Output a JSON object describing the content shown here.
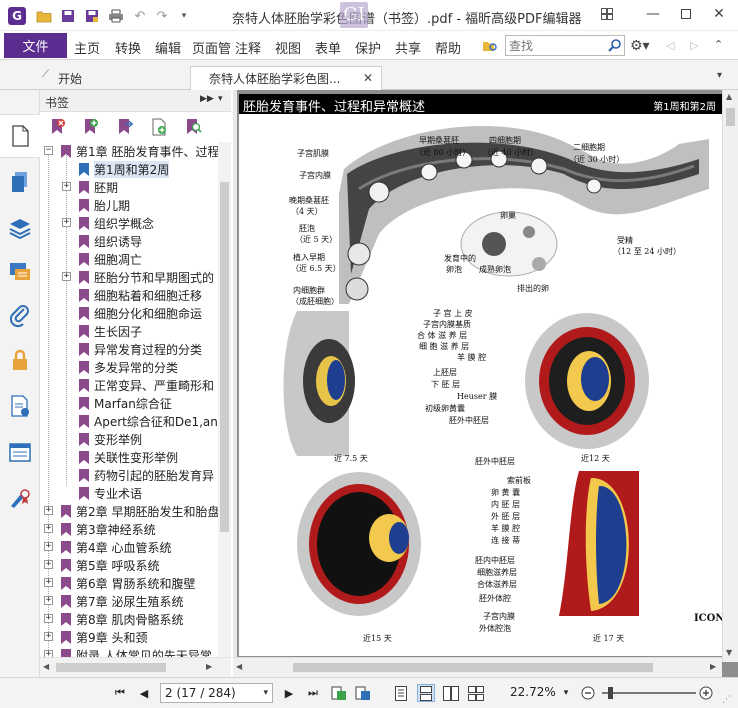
{
  "app": {
    "window_title": "奈特人体胚胎学彩色图谱（书签）.pdf - 福昕高级PDF编辑器",
    "colors": {
      "accent": "#5c2d91",
      "selection": "#dbe5f3",
      "bookmark": "#8b4a8c"
    }
  },
  "menu": {
    "file": "文件",
    "items": [
      "主页",
      "转换",
      "编辑",
      "页面管",
      "注释",
      "视图",
      "表单",
      "保护",
      "共享",
      "帮助"
    ],
    "search_placeholder": "查找"
  },
  "tabs": {
    "start": "开始",
    "document": "奈特人体胚胎学彩色图..."
  },
  "bookmarks": {
    "header": "书签",
    "tree": [
      {
        "label": "第1章 胚胎发育事件、过程",
        "expander": "−"
      },
      {
        "label": "第1周和第2周",
        "expander": ""
      },
      {
        "label": "胚期",
        "expander": "+"
      },
      {
        "label": "胎儿期",
        "expander": ""
      },
      {
        "label": "组织学概念",
        "expander": "+"
      },
      {
        "label": "组织诱导",
        "expander": ""
      },
      {
        "label": "细胞凋亡",
        "expander": ""
      },
      {
        "label": "胚胎分节和早期图式的",
        "expander": "+"
      },
      {
        "label": "细胞粘着和细胞迁移",
        "expander": ""
      },
      {
        "label": "细胞分化和细胞命运",
        "expander": ""
      },
      {
        "label": "生长因子",
        "expander": ""
      },
      {
        "label": "异常发育过程的分类",
        "expander": ""
      },
      {
        "label": "多发异常的分类",
        "expander": ""
      },
      {
        "label": "正常变异、严重畸形和",
        "expander": ""
      },
      {
        "label": "Marfan综合征",
        "expander": ""
      },
      {
        "label": "Apert综合征和De1,an",
        "expander": ""
      },
      {
        "label": "变形举例",
        "expander": ""
      },
      {
        "label": "关联性变形举例",
        "expander": ""
      },
      {
        "label": "药物引起的胚胎发育异",
        "expander": ""
      },
      {
        "label": "专业术语",
        "expander": ""
      },
      {
        "label": "第2章 早期胚胎发生和胎盘",
        "expander": "+"
      },
      {
        "label": "第3章神经系统",
        "expander": "+"
      },
      {
        "label": "第4章 心血管系统",
        "expander": "+"
      },
      {
        "label": "第5章 呼吸系统",
        "expander": "+"
      },
      {
        "label": "第6章 胃肠系统和腹壁",
        "expander": "+"
      },
      {
        "label": "第7章 泌尿生殖系统",
        "expander": "+"
      },
      {
        "label": "第8章 肌肉骨骼系统",
        "expander": "+"
      },
      {
        "label": "第9章 头和颈",
        "expander": "+"
      },
      {
        "label": "附录 人体常见的先天异常",
        "expander": "+"
      }
    ]
  },
  "document": {
    "page_heading": "胚胎发育事件、过程和异常概述",
    "page_subheading": "第1周和第2周",
    "labels_top": {
      "zygote": "受精",
      "zygote_time": "（12 至 24 小时）",
      "early_morula": "早期桑葚胚",
      "early_morula_time": "（近 80 小时）",
      "four_cell": "四细胞期",
      "four_cell_time": "（近 40 小时）",
      "two_cell": "二细胞期",
      "two_cell_time": "（近 30 小时）",
      "uterine_muscle": "子宫肌膜",
      "endometrium": "子宫内膜",
      "late_morula": "晚期桑葚胚",
      "late_morula_time": "（4 天）",
      "blastocyst": "胚泡",
      "blastocyst_time": "（近 5 天）",
      "early_implant": "植入早期",
      "early_implant_time": "（近 6.5 天）",
      "inner_cell_mass": "内细胞群",
      "inner_cell_mass_sub": "（成胚细胞）",
      "ovary": "卵巢",
      "developing_follicle": "发育中的",
      "developing_follicle_b": "卵泡",
      "mature_follicle": "成熟卵泡",
      "ovulated_egg": "排出的卵"
    },
    "labels_mid": [
      "子 宫 上 皮",
      "子宫内膜基质",
      "合 体 滋 养 层",
      "细 胞 滋 养 层",
      "羊 膜 腔",
      "上胚层",
      "下 胚 层",
      "Heuser 膜",
      "初级卵黄囊",
      "胚外中胚层"
    ],
    "labels_bottom": [
      "胚外中胚层",
      "索前板",
      "卵 黄 囊",
      "内 胚 层",
      "外 胚 层",
      "羊 膜 腔",
      "连 接 蒂",
      "胚内中胚层",
      "细胞滋养层",
      "合体滋养层",
      "胚外体腔",
      "子宫内膜",
      "外体腔泡"
    ],
    "day_labels": [
      "近 7.5 天",
      "近12 天",
      "近15 天",
      "近 17 天"
    ],
    "publisher": "ICON"
  },
  "status": {
    "page_box": "2 (17 / 284)",
    "zoom": "22.72%"
  }
}
